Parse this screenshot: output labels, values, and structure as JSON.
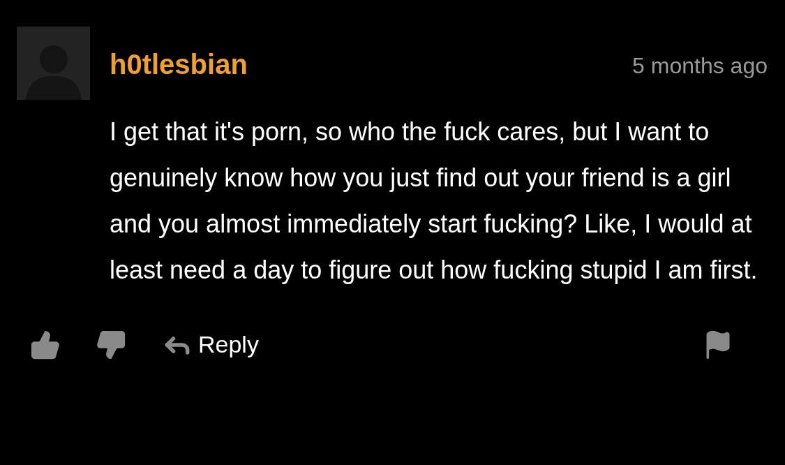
{
  "comment": {
    "username": "h0tlesbian",
    "time": "5 months ago",
    "text": "I get that it's porn, so who the fuck cares, but I want to genuinely know how you just find out your friend is a girl and you almost immediately start fucking? Like, I would at least need a day to figure out how fucking stupid I am first.",
    "reply_label": "Reply"
  }
}
